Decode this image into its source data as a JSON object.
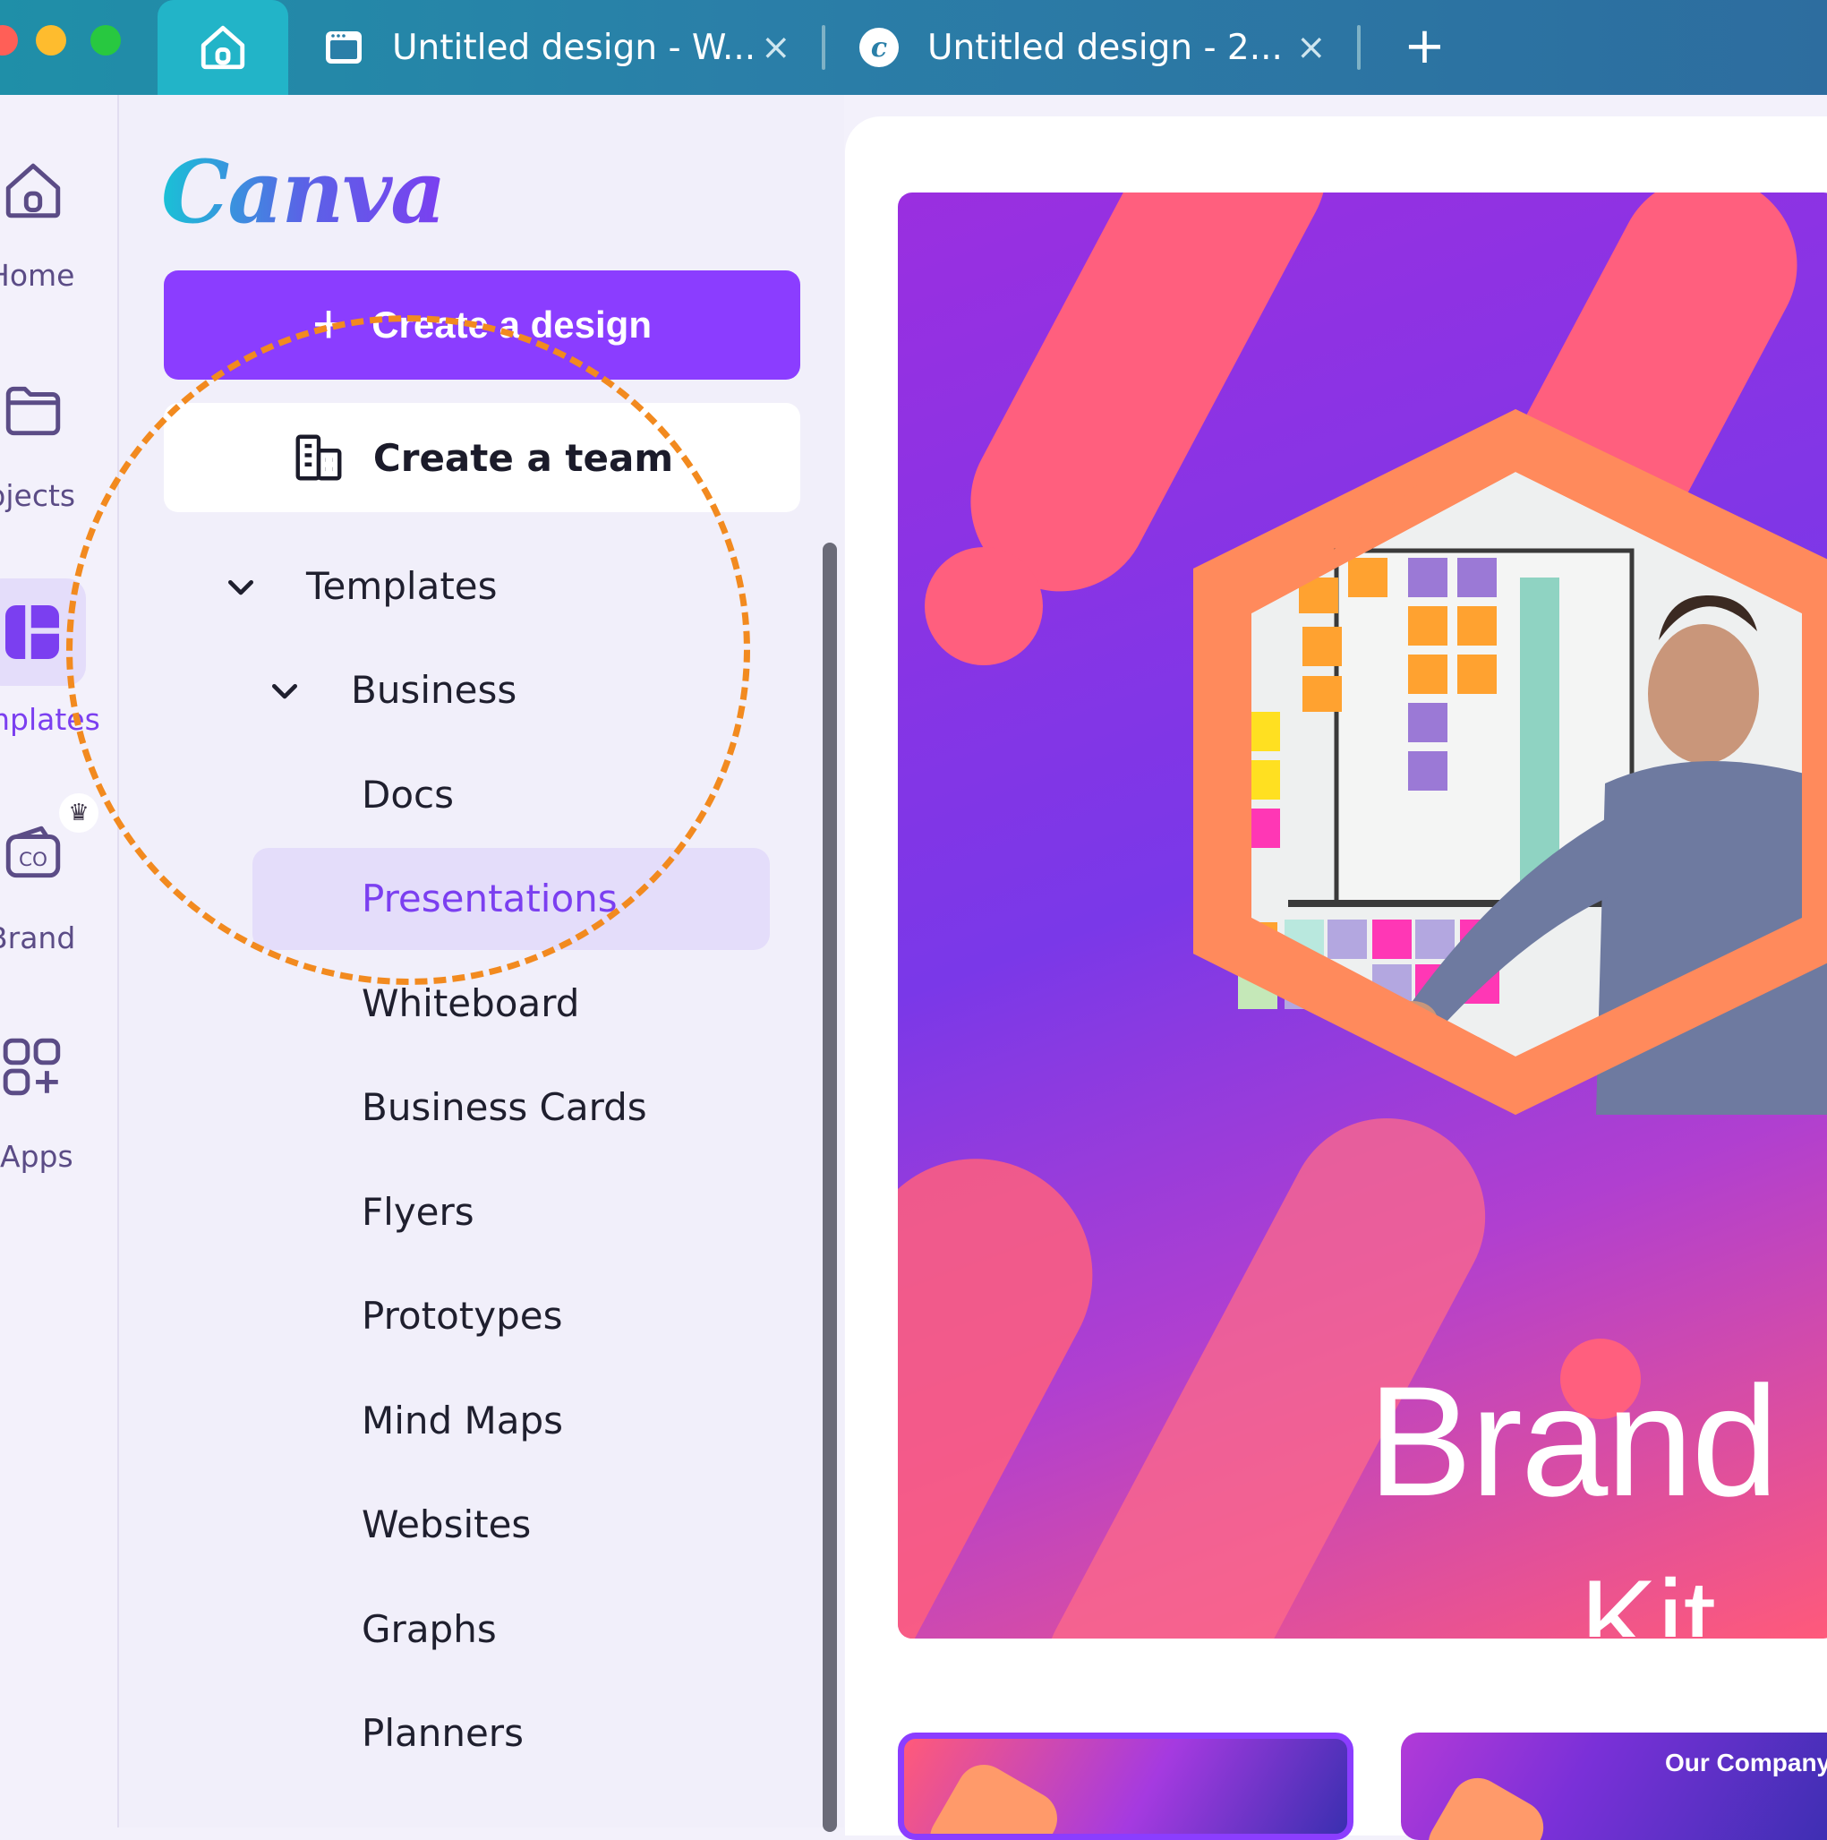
{
  "browser": {
    "tabs": [
      {
        "title": "Untitled design - W...",
        "icon": "whiteboard-icon"
      },
      {
        "title": "Untitled design - 2...",
        "icon": "canva-icon"
      }
    ],
    "home_tab_icon": "home-icon",
    "new_tab_label": "+",
    "close_label": "×"
  },
  "rail": {
    "items": [
      {
        "label": "Home",
        "icon": "home-icon"
      },
      {
        "label": "Projects",
        "icon": "folder-icon"
      },
      {
        "label": "Templates",
        "icon": "templates-icon",
        "active": true
      },
      {
        "label": "Brand",
        "icon": "brand-icon"
      },
      {
        "label": "Apps",
        "icon": "apps-icon"
      }
    ]
  },
  "panel": {
    "logo": "Canva",
    "create_design_label": "Create a design",
    "create_team_label": "Create a team",
    "tree": {
      "templates": "Templates",
      "business": "Business",
      "items": [
        "Docs",
        "Presentations",
        "Whiteboard",
        "Business Cards",
        "Flyers",
        "Prototypes",
        "Mind Maps",
        "Websites",
        "Graphs",
        "Planners"
      ],
      "selected": "Presentations"
    }
  },
  "preview": {
    "title": "Brand",
    "subtitle": "Kit",
    "thumbnails": [
      "Our Company"
    ]
  },
  "colors": {
    "accent": "#8b3dff",
    "selected_bg": "#e4ddfa",
    "highlight_ring": "#f28a1f",
    "tabbar": "#2a7fa8"
  }
}
